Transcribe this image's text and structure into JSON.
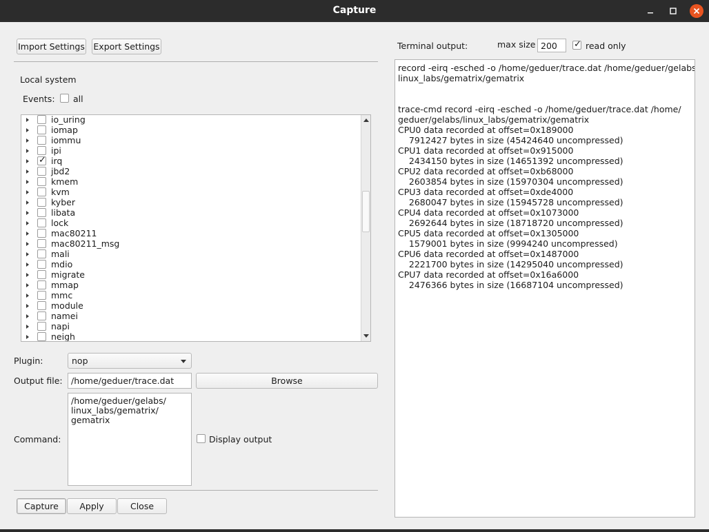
{
  "window": {
    "title": "Capture"
  },
  "toolbar": {
    "import_label": "Import Settings",
    "export_label": "Export Settings"
  },
  "local": {
    "heading": "Local system",
    "events_label": "Events:",
    "all_label": "all",
    "all_checked": false
  },
  "events": [
    {
      "name": "io_uring",
      "checked": false
    },
    {
      "name": "iomap",
      "checked": false
    },
    {
      "name": "iommu",
      "checked": false
    },
    {
      "name": "ipi",
      "checked": false
    },
    {
      "name": "irq",
      "checked": true
    },
    {
      "name": "jbd2",
      "checked": false
    },
    {
      "name": "kmem",
      "checked": false
    },
    {
      "name": "kvm",
      "checked": false
    },
    {
      "name": "kyber",
      "checked": false
    },
    {
      "name": "libata",
      "checked": false
    },
    {
      "name": "lock",
      "checked": false
    },
    {
      "name": "mac80211",
      "checked": false
    },
    {
      "name": "mac80211_msg",
      "checked": false
    },
    {
      "name": "mali",
      "checked": false
    },
    {
      "name": "mdio",
      "checked": false
    },
    {
      "name": "migrate",
      "checked": false
    },
    {
      "name": "mmap",
      "checked": false
    },
    {
      "name": "mmc",
      "checked": false
    },
    {
      "name": "module",
      "checked": false
    },
    {
      "name": "namei",
      "checked": false
    },
    {
      "name": "napi",
      "checked": false
    },
    {
      "name": "neigh",
      "checked": false
    }
  ],
  "plugin": {
    "label": "Plugin:",
    "value": "nop"
  },
  "output": {
    "label": "Output file:",
    "value": "/home/geduer/trace.dat",
    "browse_label": "Browse"
  },
  "command": {
    "label": "Command:",
    "text": "/home/geduer/gelabs/\nlinux_labs/gematrix/\ngematrix",
    "display_output_label": "Display output",
    "display_output_checked": false
  },
  "actions": {
    "capture_label": "Capture",
    "apply_label": "Apply",
    "close_label": "Close"
  },
  "terminal": {
    "label": "Terminal output:",
    "max_size_label": "max size",
    "max_size_value": "200",
    "read_only_label": "read only",
    "read_only_checked": true,
    "text": "record -eirq -esched -o /home/geduer/trace.dat /home/geduer/gelabs/\nlinux_labs/gematrix/gematrix\n\n\ntrace-cmd record -eirq -esched -o /home/geduer/trace.dat /home/\ngeduer/gelabs/linux_labs/gematrix/gematrix\nCPU0 data recorded at offset=0x189000\n    7912427 bytes in size (45424640 uncompressed)\nCPU1 data recorded at offset=0x915000\n    2434150 bytes in size (14651392 uncompressed)\nCPU2 data recorded at offset=0xb68000\n    2603854 bytes in size (15970304 uncompressed)\nCPU3 data recorded at offset=0xde4000\n    2680047 bytes in size (15945728 uncompressed)\nCPU4 data recorded at offset=0x1073000\n    2692644 bytes in size (18718720 uncompressed)\nCPU5 data recorded at offset=0x1305000\n    1579001 bytes in size (9994240 uncompressed)\nCPU6 data recorded at offset=0x1487000\n    2221700 bytes in size (14295040 uncompressed)\nCPU7 data recorded at offset=0x16a6000\n    2476366 bytes in size (16687104 uncompressed)"
  }
}
